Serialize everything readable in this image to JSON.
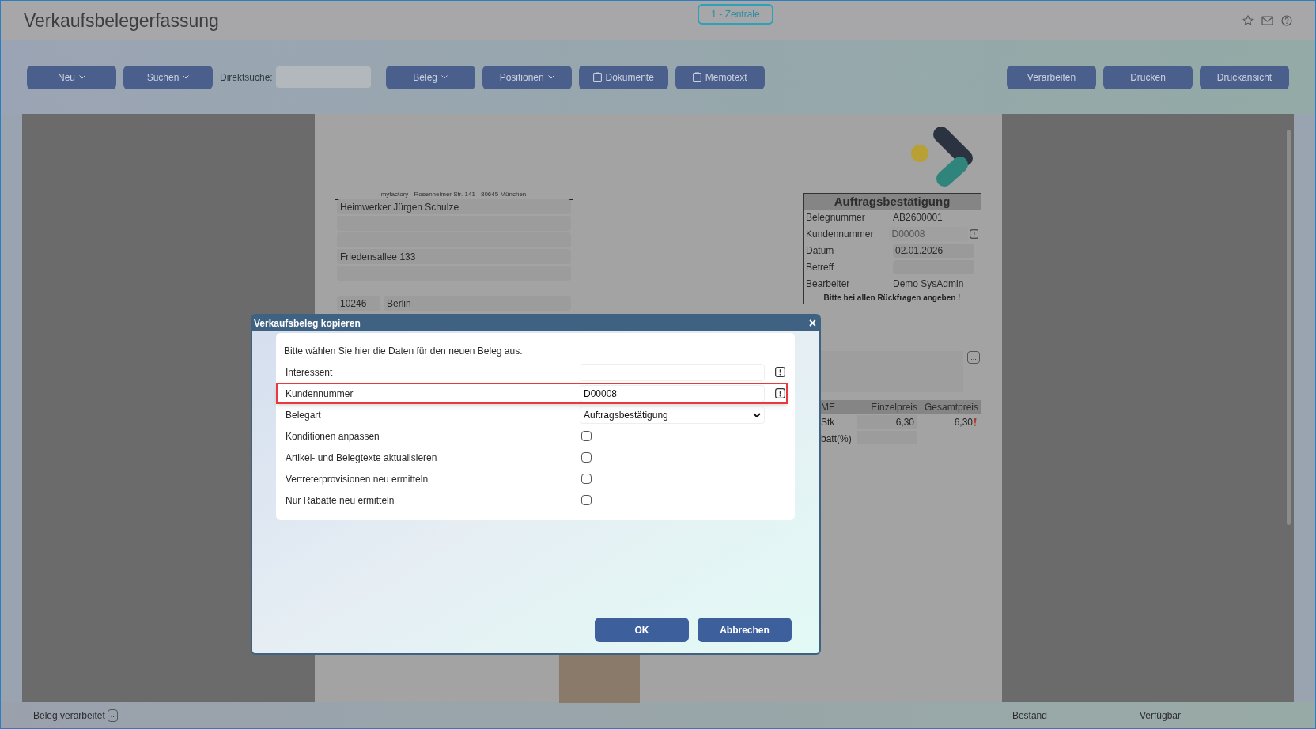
{
  "header": {
    "title": "Verkaufsbelegerfassung",
    "location_badge": "1 - Zentrale"
  },
  "toolbar": {
    "left_buttons": [
      {
        "label": "Neu",
        "kind": "dropdown"
      },
      {
        "label": "Suchen",
        "kind": "dropdown"
      }
    ],
    "direct_search": {
      "label": "Direktsuche:"
    },
    "middle_buttons": [
      {
        "label": "Beleg",
        "kind": "dropdown"
      },
      {
        "label": "Positionen",
        "kind": "dropdown"
      },
      {
        "label": "Dokumente",
        "kind": "clipboard"
      },
      {
        "label": "Memotext",
        "kind": "clipboard"
      }
    ],
    "right_buttons": [
      {
        "label": "Verarbeiten"
      },
      {
        "label": "Drucken"
      },
      {
        "label": "Druckansicht"
      }
    ]
  },
  "document": {
    "sender_line": "myfactory - Rosenheimer Str. 141 - 80645 München",
    "address": {
      "name": "Heimwerker Jürgen Schulze",
      "street": "Friedensallee 133",
      "zip": "10246",
      "city": "Berlin"
    },
    "info_box": {
      "title": "Auftragsbestätigung",
      "rows": [
        {
          "label": "Belegnummer",
          "value": "AB2600001",
          "kind": "text"
        },
        {
          "label": "Kundennummer",
          "value": "D00008",
          "kind": "lookup",
          "disabled": true
        },
        {
          "label": "Datum",
          "value": "02.01.2026",
          "kind": "field",
          "disabled": false
        },
        {
          "label": "Betreff",
          "kind": "field"
        },
        {
          "label": "Bearbeiter",
          "value": "Demo SysAdmin",
          "kind": "text"
        }
      ],
      "note": "Bitte bei allen Rückfragen angeben !"
    },
    "memo_button": "...",
    "positions": {
      "columns": [
        "ME",
        "Einzelpreis",
        "Gesamtpreis"
      ],
      "row": {
        "unit": "Stk",
        "price": "6,30",
        "total": "6,30"
      },
      "discount_label": "batt(%)"
    }
  },
  "dialog": {
    "title": "Verkaufsbeleg kopieren",
    "close": "×",
    "intro": "Bitte wählen Sie hier die Daten für den neuen Beleg aus.",
    "fields": [
      {
        "kind": "lookup",
        "label": "Interessent",
        "highlighted": false
      },
      {
        "kind": "lookup",
        "label": "Kundennummer",
        "value": "D00008",
        "highlighted": true
      },
      {
        "kind": "select",
        "label": "Belegart",
        "value": "Auftragsbestätigung",
        "highlighted": false
      },
      {
        "kind": "checkbox",
        "label": "Konditionen anpassen",
        "checked": false,
        "highlighted": false
      },
      {
        "kind": "checkbox",
        "label": "Artikel- und Belegtexte aktualisieren",
        "checked": false,
        "highlighted": false
      },
      {
        "kind": "checkbox",
        "label": "Vertreterprovisionen neu ermitteln",
        "checked": false,
        "highlighted": false
      },
      {
        "kind": "checkbox",
        "label": "Nur Rabatte neu ermitteln",
        "checked": false,
        "highlighted": false
      }
    ],
    "buttons": [
      "OK",
      "Abbrechen"
    ]
  },
  "status_bar": {
    "left": "Beleg verarbeitet",
    "left_button": "..",
    "right": [
      "Bestand",
      "Verfügbar"
    ]
  }
}
